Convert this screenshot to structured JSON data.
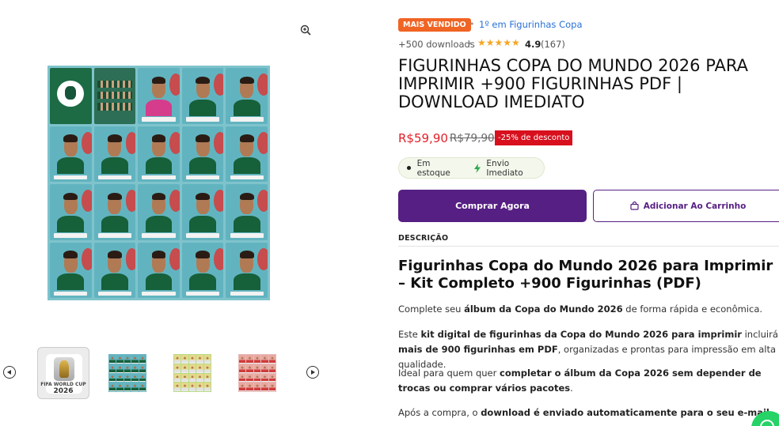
{
  "gallery": {
    "thumbs": [
      {
        "name": "world-cup-logo",
        "logo_text": "FIFA WORLD CUP",
        "logo_year": "2026"
      },
      {
        "name": "mexico-sheet"
      },
      {
        "name": "yellow-sheet"
      },
      {
        "name": "red-sheet"
      }
    ]
  },
  "product": {
    "badge": "MAIS VENDIDO",
    "rank_link": "1º em Figurinhas Copa",
    "downloads": "+500 downloads",
    "separator": "•",
    "rating_stars": "★★★★★",
    "rating_value": "4.9",
    "reviews": "(167)",
    "title": "FIGURINHAS COPA DO MUNDO 2026 PARA IMPRIMIR +900 FIGURINHAS PDF | DOWNLOAD IMEDIATO",
    "price": "R$59,90",
    "old_price": "R$79,90",
    "discount": "-25% de desconto",
    "stock": "Em estoque",
    "shipping": "Envio Imediato",
    "buy_label": "Comprar Agora",
    "cart_label": "Adicionar Ao Carrinho"
  },
  "description": {
    "tab_label": "DESCRIÇÃO",
    "heading": "Figurinhas Copa do Mundo 2026 para Imprimir – Kit Completo +900 Figurinhas (PDF)",
    "p1": {
      "a": "Complete seu ",
      "b": "álbum da Copa do Mundo 2026",
      "c": " de forma rápida e econômica."
    },
    "p2": {
      "a": "Este ",
      "b": "kit digital de figurinhas da Copa do Mundo 2026 para imprimir",
      "c": " incluirá ",
      "d": "mais de 900 figurinhas em PDF",
      "e": ", organizadas e prontas para impressão em alta qualidade."
    },
    "p3": {
      "a": "Ideal para quem quer ",
      "b": "completar o álbum da Copa 2026 sem depender de trocas ou comprar vários pacotes",
      "c": "."
    },
    "p4": {
      "a": "Após a compra, o ",
      "b": "download é enviado automaticamente para o seu e-mail",
      "c": "."
    }
  },
  "colors": {
    "accent": "#561f83",
    "price": "#e41e26",
    "badge": "#f06424",
    "discount": "#d8101e",
    "link": "#2970d6",
    "whatsapp": "#25d366"
  },
  "icons": [
    "zoom-in-icon",
    "chevron-left-icon",
    "chevron-right-icon",
    "bolt-icon",
    "shopping-bag-icon",
    "whatsapp-icon",
    "star-icon"
  ]
}
